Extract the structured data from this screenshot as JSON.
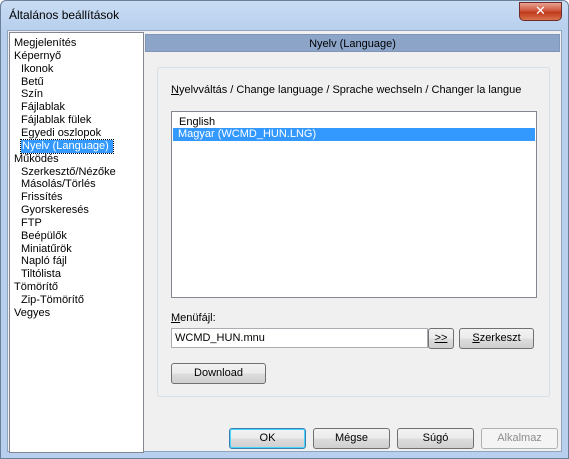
{
  "window": {
    "title": "Általános beállítások",
    "close_glyph": "✕"
  },
  "tree": {
    "items": [
      {
        "label": "Megjelenítés",
        "indent": 0
      },
      {
        "label": "Képernyő",
        "indent": 0
      },
      {
        "label": "Ikonok",
        "indent": 1
      },
      {
        "label": "Betű",
        "indent": 1
      },
      {
        "label": "Szín",
        "indent": 1
      },
      {
        "label": "Fájlablak",
        "indent": 1
      },
      {
        "label": "Fájlablak fülek",
        "indent": 1
      },
      {
        "label": "Egyedi oszlopok",
        "indent": 1
      },
      {
        "label": "Nyelv (Language)",
        "indent": 1,
        "selected": true
      },
      {
        "label": "Működés",
        "indent": 0
      },
      {
        "label": "Szerkesztő/Nézőke",
        "indent": 1
      },
      {
        "label": "Másolás/Törlés",
        "indent": 1
      },
      {
        "label": "Frissítés",
        "indent": 1
      },
      {
        "label": "Gyorskeresés",
        "indent": 1
      },
      {
        "label": "FTP",
        "indent": 1
      },
      {
        "label": "Beépülők",
        "indent": 1
      },
      {
        "label": "Miniatűrök",
        "indent": 1
      },
      {
        "label": "Napló fájl",
        "indent": 1
      },
      {
        "label": "Tiltólista",
        "indent": 1
      },
      {
        "label": "Tömörítő",
        "indent": 0
      },
      {
        "label": "Zip-Tömörítő",
        "indent": 1
      },
      {
        "label": "Vegyes",
        "indent": 0
      }
    ]
  },
  "panel": {
    "header": "Nyelv (Language)",
    "language_label": "Nyelvváltás / Change language / Sprache wechseln / Changer la langue",
    "languages": [
      {
        "label": "English",
        "selected": false
      },
      {
        "label": "Magyar (WCMD_HUN.LNG)",
        "selected": true
      }
    ],
    "menu_file_label": "Menüfájl:",
    "menu_file_value": "WCMD_HUN.mnu",
    "browse_label": ">>",
    "edit_label": "Szerkeszt",
    "download_label": "Download"
  },
  "footer": {
    "ok_label": "OK",
    "cancel_label": "Mégse",
    "help_label": "Súgó",
    "apply_label": "Alkalmaz"
  },
  "colors": {
    "selection": "#3399ff",
    "header_band": "#8ba4c8",
    "title_bar": "#b8d0ee",
    "close_button": "#c0391d"
  }
}
